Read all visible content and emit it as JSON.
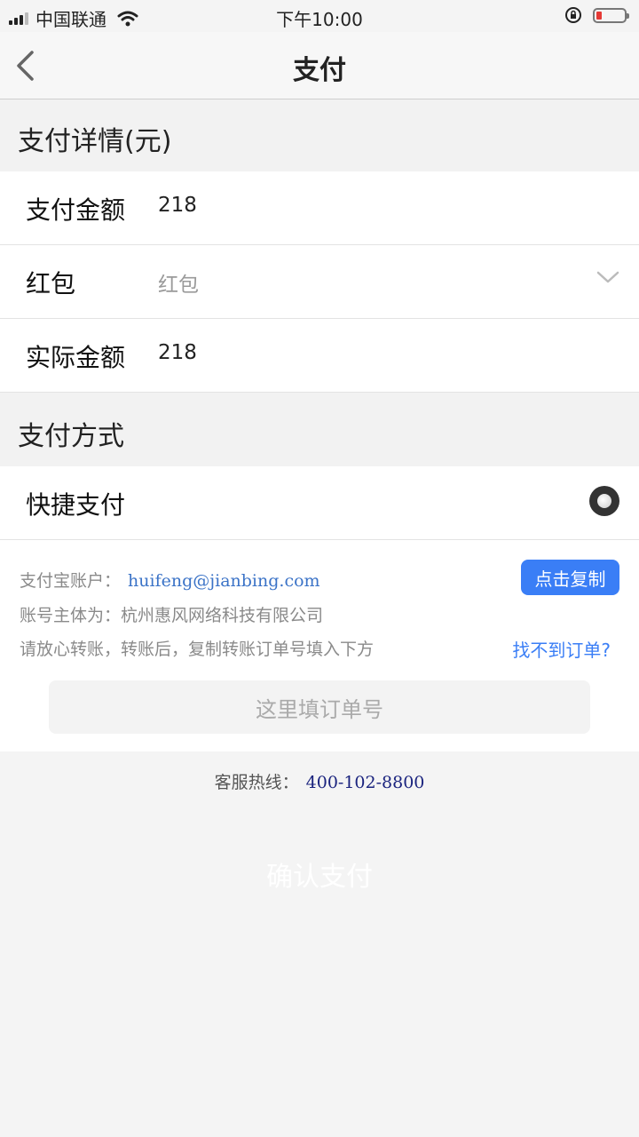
{
  "status_bar": {
    "carrier": "中国联通",
    "time": "下午10:00",
    "colors": {
      "battery_low": "#e53935"
    }
  },
  "nav": {
    "title": "支付",
    "back_icon": "chevron-left-icon"
  },
  "payment_details": {
    "header": "支付详情(元)",
    "rows": [
      {
        "label": "支付金额",
        "value": "218"
      },
      {
        "label": "红包",
        "value": "红包"
      },
      {
        "label": "实际金额",
        "value": "218"
      }
    ]
  },
  "payment_method": {
    "header": "支付方式",
    "option_label": "快捷支付",
    "selected": true
  },
  "transfer_info": {
    "alipay_label": "支付宝账户：",
    "alipay_account": "huifeng@jianbing.com",
    "copy_button": "点击复制",
    "entity_line": "账号主体为：杭州惠风网络科技有限公司",
    "instruction": "请放心转账，转账后，复制转账订单号填入下方",
    "find_order_link": "找不到订单?",
    "order_placeholder": "这里填订单号",
    "colors": {
      "accent": "#3a7ef6"
    }
  },
  "footer": {
    "hotline_label": "客服热线：",
    "hotline_number": "400-102-8800",
    "confirm_button": "确认支付"
  }
}
